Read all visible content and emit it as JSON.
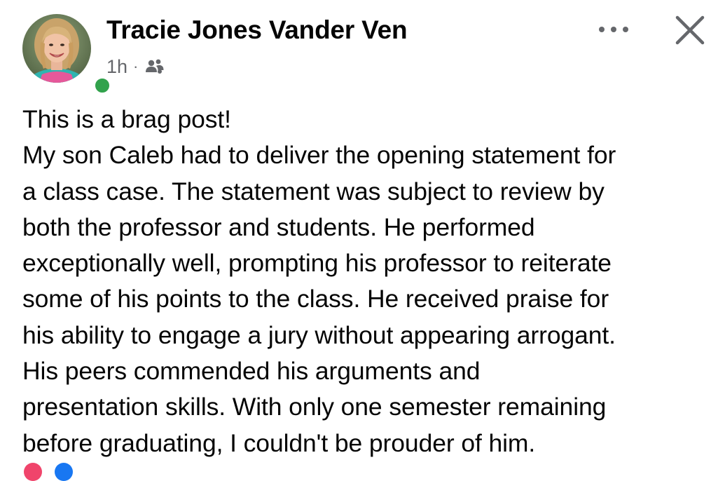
{
  "post": {
    "author_name": "Tracie Jones Vander Ven",
    "timestamp": "1h",
    "separator": "·",
    "audience_icon": "friends-icon",
    "more_icon": "more-horizontal-icon",
    "close_icon": "close-icon",
    "online_status_color": "#31a24c",
    "lines": [
      "This is a brag post!",
      "My son Caleb had to deliver the opening statement for",
      "a class case. The statement was subject to review by",
      "both the professor and students. He performed",
      "exceptionally well, prompting his professor to reiterate",
      "some of his points to the class. He received praise for",
      "his ability to engage a jury without appearing arrogant.",
      "His peers commended his arguments and",
      "presentation skills. With only one semester remaining",
      "before graduating, I couldn't be prouder of him."
    ]
  },
  "colors": {
    "text_primary": "#050505",
    "text_secondary": "#65676b",
    "online": "#31a24c"
  }
}
